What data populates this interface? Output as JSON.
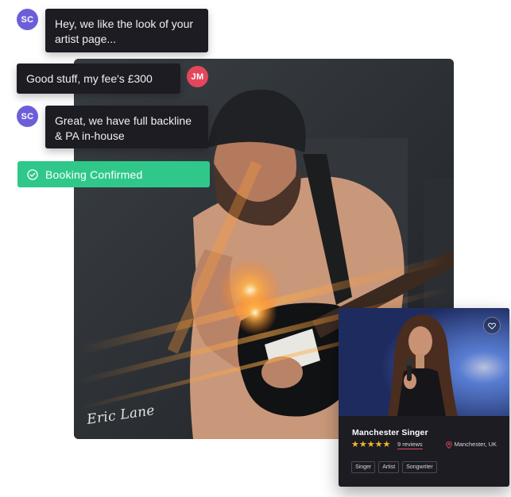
{
  "chat": {
    "messages": [
      {
        "sender": "SC",
        "text": "Hey, we like the look of your artist page..."
      },
      {
        "sender": "JM",
        "text": "Good stuff, my fee's £300"
      },
      {
        "sender": "SC",
        "text": "Great, we have full backline & PA in-house"
      }
    ],
    "status": {
      "label": "Booking Confirmed",
      "icon": "check-circle-icon",
      "color": "#2fc88a"
    }
  },
  "avatars": {
    "sc": {
      "initials": "SC",
      "color": "#6b5fd9"
    },
    "jm": {
      "initials": "JM",
      "color": "#e4475b"
    }
  },
  "hero": {
    "signature": "Eric Lane"
  },
  "listing": {
    "title": "Manchester Singer",
    "rating": 5,
    "stars": "★★★★★",
    "reviews": "9 reviews",
    "location": "Manchester, UK",
    "location_icon": "map-pin-icon",
    "favorite_icon": "heart-icon",
    "tags": [
      "Singer",
      "Artist",
      "Songwriter"
    ]
  },
  "colors": {
    "bubble_bg": "#1c1c22",
    "star": "#f5b824",
    "accent_red": "#e24b5e"
  }
}
